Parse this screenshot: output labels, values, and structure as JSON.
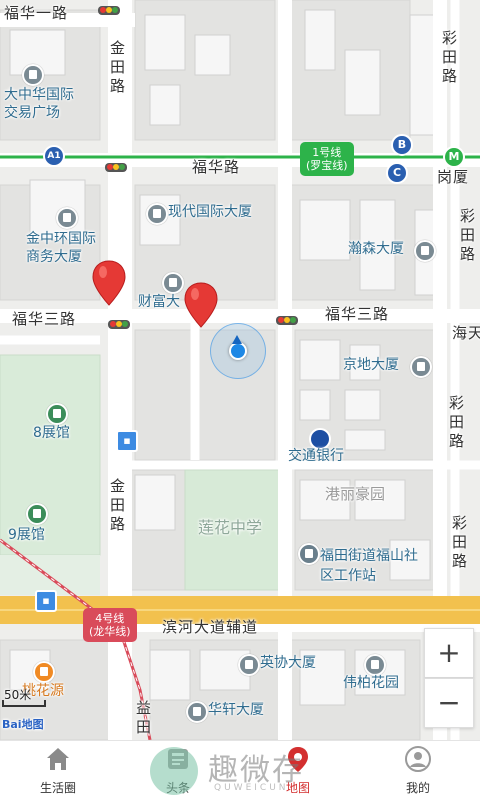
{
  "map": {
    "roads": {
      "fuhua1": "福华一路",
      "fuhua": "福华路",
      "fuhua3_left": "福华三路",
      "fuhua3_right": "福华三路",
      "jintian_top": "金田路",
      "jintian_bottom": "金田路",
      "caitian_top": "彩田路",
      "caitian_mid": "彩田路",
      "caitian_mid2": "彩田路",
      "caitian_bottom": "彩田路",
      "binhe": "滨河大道辅道",
      "gangxia": "岗厦",
      "haitian": "海天",
      "yitian": "益田"
    },
    "pois": {
      "dazhonghua": "大中华国际交易广场",
      "xiandai": "现代国际大厦",
      "jinzhonghuan": "金中环国际商务大厦",
      "hansen": "瀚森大厦",
      "caifu": "财富大",
      "jingdi": "京地大厦",
      "zhanguan8": "8展馆",
      "jiaotong": "交通银行",
      "gangli": "港丽豪园",
      "lianhua": "莲花中学",
      "zhanguan9": "9展馆",
      "futian_office": "福田街道福山社区工作站",
      "yingxie": "英协大厦",
      "weibai": "伟柏花园",
      "huaxuan": "华轩大厦",
      "taohuayuan": "桃花源"
    },
    "metro": {
      "line1": "1号线",
      "line1_sub": "(罗宝线)",
      "line4": "4号线",
      "line4_sub": "(龙华线)",
      "badge_a1": "A1",
      "badge_b": "B",
      "badge_c": "C"
    },
    "scale": "50米",
    "logo": "Bai地图",
    "zoom_in": "+",
    "zoom_out": "−",
    "colors": {
      "metro_line1": "#2db34a",
      "metro_line4": "#d94b5a",
      "pin": "#e53935",
      "location": "#1e88e5",
      "main_road": "#f2c14e"
    }
  },
  "tabs": [
    {
      "label": "生活圈",
      "icon": "home-icon",
      "active": false
    },
    {
      "label": "头条",
      "icon": "headline-icon",
      "active": false
    },
    {
      "label": "地图",
      "icon": "map-pin-icon",
      "active": true
    },
    {
      "label": "我的",
      "icon": "profile-icon",
      "active": false
    }
  ],
  "watermark": {
    "brand": "趣微存",
    "sub": "QUWEICUN"
  }
}
